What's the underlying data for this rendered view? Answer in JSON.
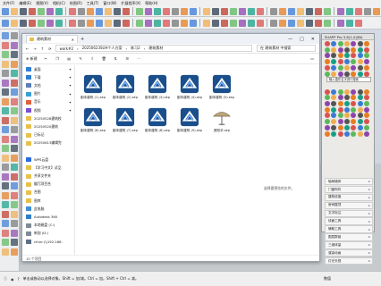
{
  "menubar": [
    "文件(F)",
    "编辑(E)",
    "视图(V)",
    "相机(C)",
    "绘图(R)",
    "工具(T)",
    "窗口(W)",
    "扩展程序(X)",
    "帮助(H)"
  ],
  "explorer": {
    "tab_title": "建筑素材",
    "window_buttons": [
      "—",
      "□",
      "✕"
    ],
    "breadcrumb": [
      "work#2",
      "20250623SUH个人方案",
      "练习2",
      "建筑素材"
    ],
    "search_placeholder": "在 建筑素材 中搜索",
    "new_button": "新建",
    "nav_items": [
      {
        "label": "桌面",
        "color": "#2f7fd6",
        "pin": "✦"
      },
      {
        "label": "下载",
        "color": "#2f7fd6",
        "pin": "✦"
      },
      {
        "label": "文档",
        "color": "#5b7fb8",
        "pin": "✦"
      },
      {
        "label": "图片",
        "color": "#3aa0d8",
        "pin": "✦"
      },
      {
        "label": "音乐",
        "color": "#e0603c",
        "pin": "✦"
      },
      {
        "label": "视频",
        "color": "#7a4fd0",
        "pin": "✦"
      },
      {
        "label": "20250528建筑校",
        "color": "#e7c14b",
        "pin": ""
      },
      {
        "label": "20250520建筑",
        "color": "#e7c14b",
        "pin": ""
      },
      {
        "label": "已标记",
        "color": "#e7c14b",
        "pin": ""
      },
      {
        "label": "20250613编辑完",
        "color": "#e7c14b",
        "pin": ""
      },
      {
        "label": "",
        "color": "",
        "pin": ""
      },
      {
        "label": "WPS云盘",
        "color": "#2a6de0",
        "pin": ""
      },
      {
        "label": "【学习中文】试品",
        "color": "#e7c14b",
        "pin": ""
      },
      {
        "label": "共享文件夹",
        "color": "#e7c14b",
        "pin": ""
      },
      {
        "label": "瓣冗项目合",
        "color": "#e7c14b",
        "pin": ""
      },
      {
        "label": "合图",
        "color": "#e7c14b",
        "pin": ""
      },
      {
        "label": "图库",
        "color": "#e7c14b",
        "pin": ""
      },
      {
        "label": "此电脑",
        "color": "#3c8fd8",
        "pin": ""
      },
      {
        "label": "Autodesk 360",
        "color": "#2c7fc8",
        "pin": ""
      },
      {
        "label": "本地磁盘 (C:)",
        "color": "#7e8a96",
        "pin": ""
      },
      {
        "label": "新加 (D:)",
        "color": "#7e8a96",
        "pin": ""
      },
      {
        "label": "cfuro (\\\\192.168.",
        "color": "#5b6f86",
        "pin": ""
      }
    ],
    "files": [
      "副本建筑 (1).skp",
      "副本建筑 (2).skp",
      "副本建筑 (3).skp",
      "副本建筑 (4).skp",
      "副本建筑 (5).skp",
      "副本建筑 (6).skp",
      "副本建筑 (7).skp",
      "副本建筑 (8).skp",
      "副本建筑 (9).skp",
      "遮阳伞.skp"
    ],
    "preview_text": "选择要预览的文件。",
    "footer": "10 个项目"
  },
  "panel": {
    "title": "SUAPP Pro 3.6(1.0)/BA",
    "search": "输入插件名字进行搜索",
    "categories": [
      "轴网墙体",
      "门窗构件",
      "建筑设施",
      "房间屋顶",
      "文字标注",
      "线面工具",
      "辅助工具",
      "图层群组",
      "三维体量",
      "渲染动画",
      "灯光天视"
    ]
  },
  "status": {
    "left": "单击或拖动以选择对象。Shift = 加/减。Ctrl = 加。Shift + Ctrl = 减。",
    "right": "数值"
  },
  "colors": {
    "sketchup_blue": "#1a4f8c",
    "accent": "#2f7fd6",
    "folder": "#e7c14b"
  }
}
